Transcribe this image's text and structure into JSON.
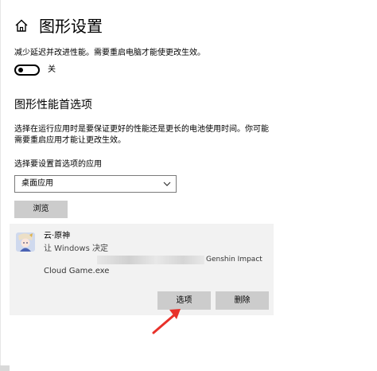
{
  "header": {
    "title": "图形设置",
    "home_icon": "home-icon"
  },
  "hardware_scheduling": {
    "description": "减少延迟并改进性能。需要重启电脑才能使更改生效。",
    "toggle_state": "关"
  },
  "graphics_preference": {
    "title": "图形性能首选项",
    "description_lines": [
      "选择在运行应用时是要保证更好的性能还是更长的电池使用时间。你可能",
      "需要重启应用才能让更改生效。"
    ],
    "select_label": "选择要设置首选项的应用",
    "select_value": "桌面应用",
    "browse_label": "浏览"
  },
  "app_card": {
    "name": "云·原神",
    "setting": "让 Windows 决定",
    "path_tail": "Genshin Impact",
    "exe": "Cloud Game.exe",
    "options_label": "选项",
    "remove_label": "删除"
  },
  "colors": {
    "annotation_arrow": "#e8312a",
    "button_bg": "#cccccc",
    "card_bg": "#f2f2f2"
  }
}
